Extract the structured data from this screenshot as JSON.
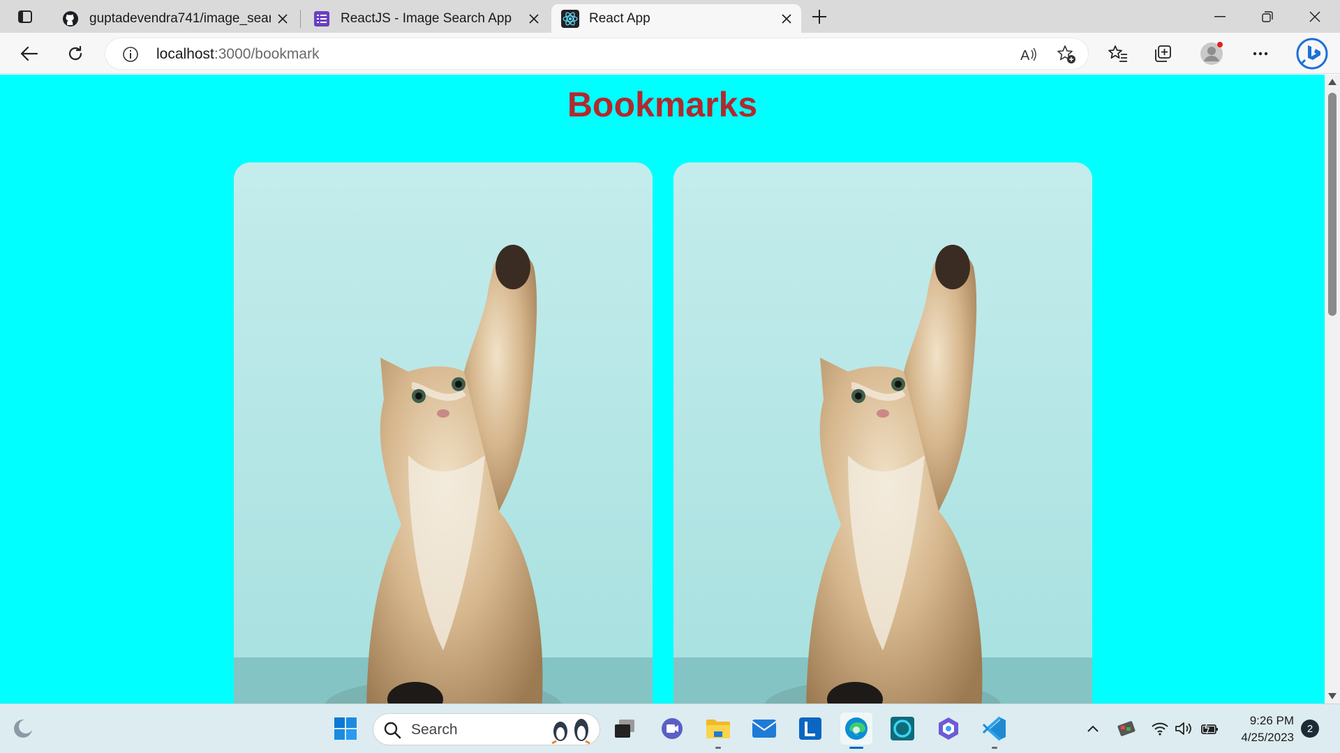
{
  "browser": {
    "tabs": [
      {
        "title": "guptadevendra741/image_searc",
        "favicon": "github-icon",
        "active": false
      },
      {
        "title": "ReactJS - Image Search App",
        "favicon": "list-doc-icon",
        "active": false
      },
      {
        "title": "React App",
        "favicon": "react-icon",
        "active": true
      }
    ],
    "address": {
      "host": "localhost",
      "path": ":3000/bookmark"
    }
  },
  "page": {
    "heading": "Bookmarks",
    "heading_color": "#b02a2e",
    "background": "#00ffff",
    "bookmarks": [
      {
        "image": "kitten-raising-paw"
      },
      {
        "image": "kitten-raising-paw"
      }
    ]
  },
  "taskbar": {
    "search_label": "Search",
    "time": "9:26 PM",
    "date": "4/25/2023",
    "notifications": "2"
  }
}
